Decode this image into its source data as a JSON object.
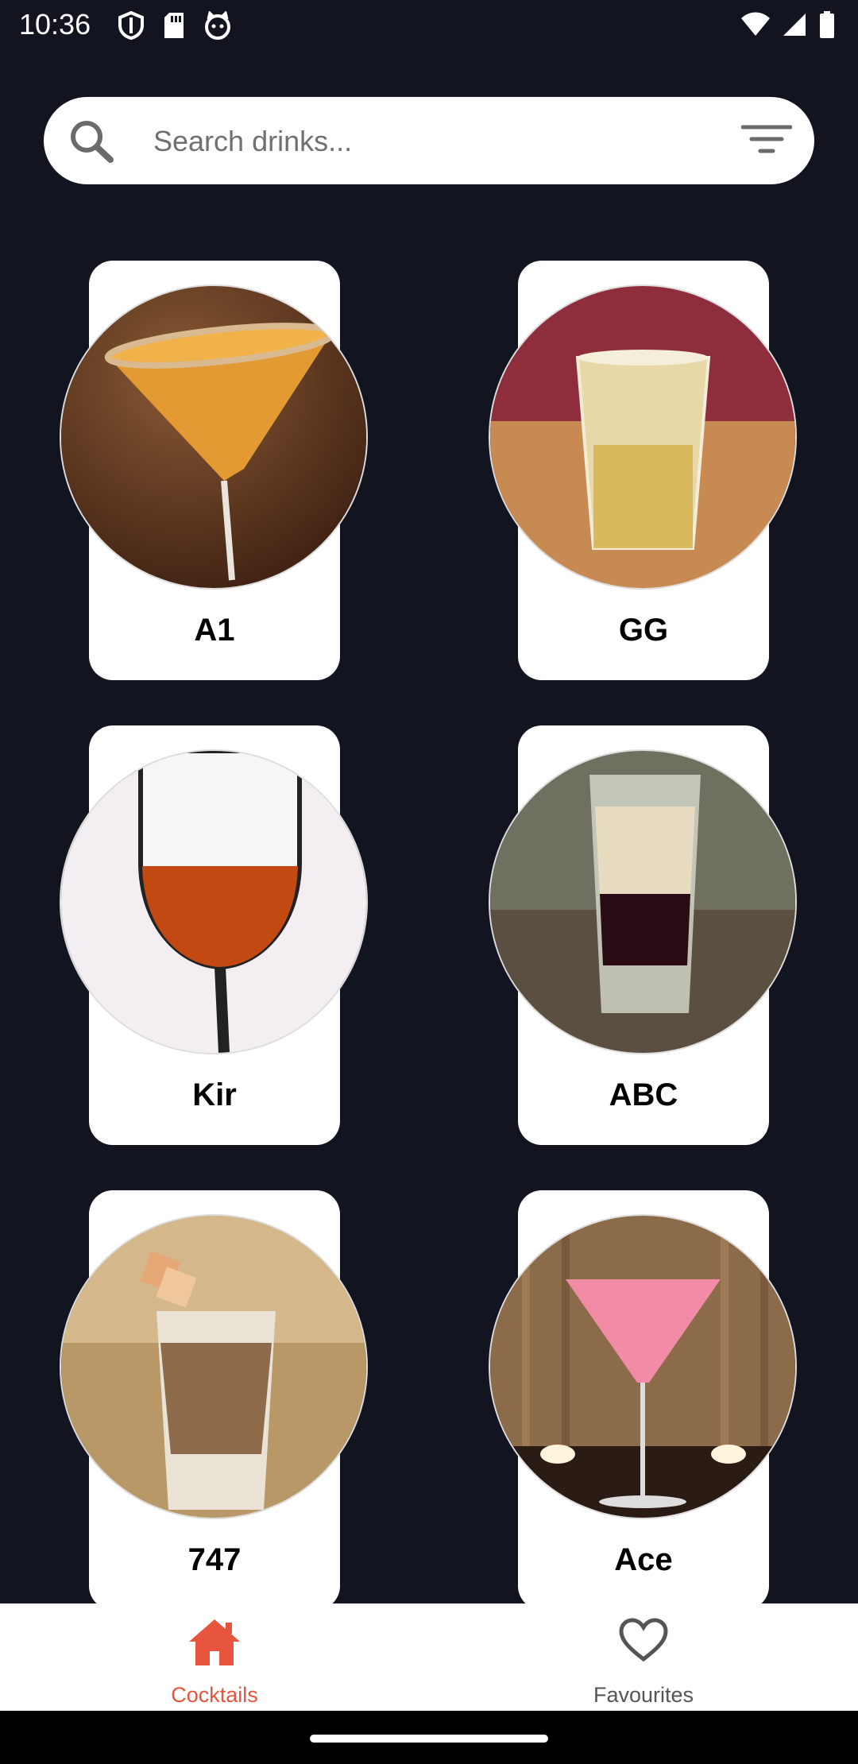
{
  "status_bar": {
    "time": "10:36"
  },
  "search": {
    "placeholder": "Search drinks..."
  },
  "drinks": [
    {
      "name": "A1"
    },
    {
      "name": "GG"
    },
    {
      "name": "Kir"
    },
    {
      "name": "ABC"
    },
    {
      "name": "747"
    },
    {
      "name": "Ace"
    }
  ],
  "bottom_nav": {
    "items": [
      {
        "label": "Cocktails",
        "icon": "home-icon",
        "active": true
      },
      {
        "label": "Favourites",
        "icon": "heart-icon",
        "active": false
      }
    ]
  },
  "colors": {
    "background": "#121420",
    "accent": "#E8553F",
    "card": "#FFFFFF",
    "inactive": "#555555"
  }
}
